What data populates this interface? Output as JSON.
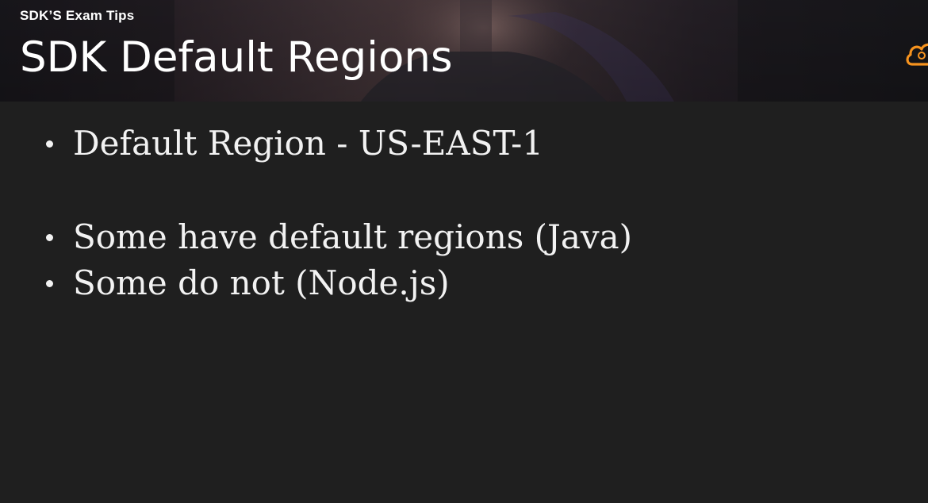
{
  "header": {
    "section_label": "SDK’S Exam Tips",
    "title": "SDK Default Regions",
    "logo_icon": "cloud-icon",
    "accent_color": "#f7931e"
  },
  "bullets": [
    {
      "text": "Default Region - US-EAST-1"
    },
    {
      "text": "Some have default regions (Java)"
    },
    {
      "text": "Some do not (Node.js)"
    }
  ]
}
